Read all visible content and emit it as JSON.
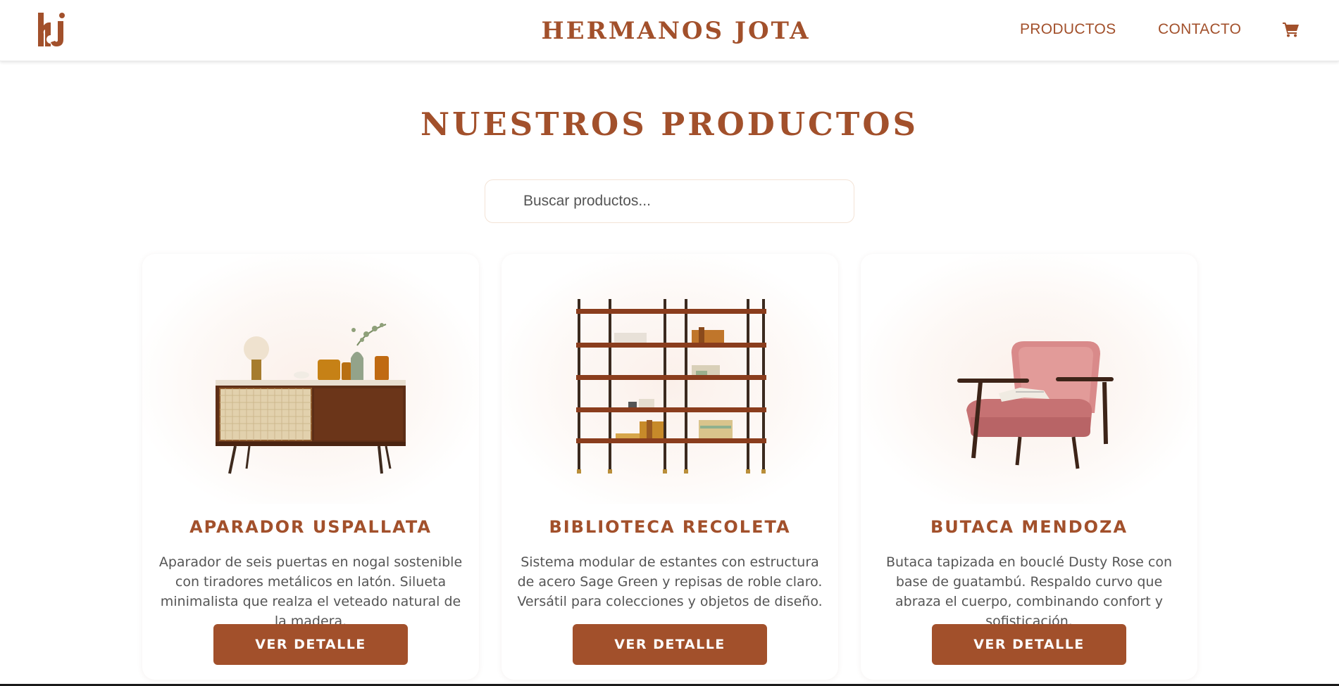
{
  "header": {
    "brand": "HERMANOS JOTA",
    "nav": {
      "productos": "PRODUCTOS",
      "contacto": "CONTACTO"
    },
    "logo_icon": "hj-monogram-logo",
    "cart_icon": "shopping-cart-icon"
  },
  "main": {
    "title": "NUESTROS PRODUCTOS",
    "search": {
      "placeholder": "Buscar productos...",
      "value": ""
    }
  },
  "products": [
    {
      "name": "APARADOR USPALLATA",
      "description": "Aparador de seis puertas en nogal sostenible con tiradores metálicos en latón. Silueta minimalista que realza el veteado natural de la madera.",
      "button": "VER DETALLE",
      "image_icon": "sideboard-image"
    },
    {
      "name": "BIBLIOTECA RECOLETA",
      "description": "Sistema modular de estantes con estructura de acero Sage Green y repisas de roble claro. Versátil para colecciones y objetos de diseño.",
      "button": "VER DETALLE",
      "image_icon": "bookshelf-image"
    },
    {
      "name": "BUTACA MENDOZA",
      "description": "Butaca tapizada en bouclé Dusty Rose con base de guatambú. Respaldo curvo que abraza el cuerpo, combinando confort y sofisticación.",
      "button": "VER DETALLE",
      "image_icon": "armchair-image"
    }
  ],
  "colors": {
    "accent": "#a2502b",
    "text_muted": "#555555",
    "background": "#ffffff"
  }
}
